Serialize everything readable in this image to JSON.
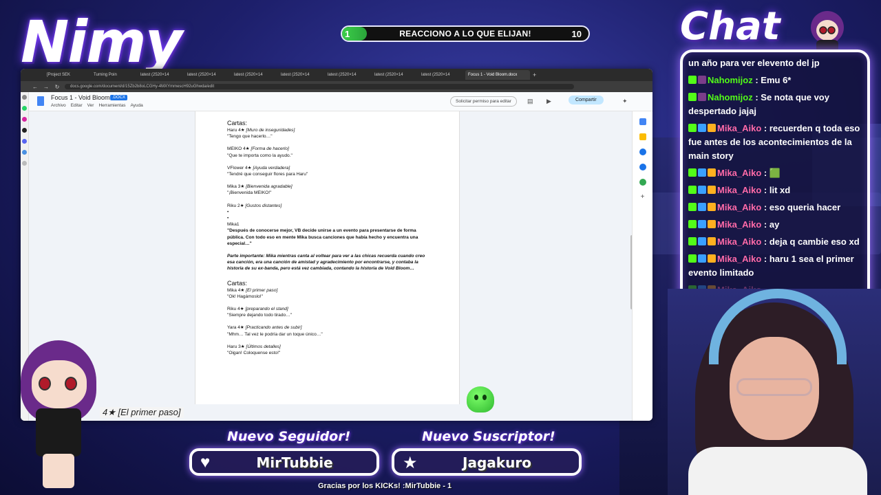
{
  "overlay": {
    "streamer_name": "Nimy",
    "chat_title": "Chat",
    "goal": {
      "label": "REACCIONO A LO QUE ELIJAN!",
      "current": "1",
      "target": "10",
      "progress": 0.1
    },
    "follower_title": "Nuevo Seguidor!",
    "follower_name": "MirTubbie",
    "sub_title": "Nuevo Suscriptor!",
    "sub_name": "Jagakuro",
    "footer": "Gracias por los KICKs! :MirTubbie - 1",
    "caption_peek": "4★ [El primer paso]"
  },
  "browser": {
    "tabs": [
      "[Project SEK",
      "Turning Poin",
      "latest (2520×14",
      "latest (2520×14",
      "latest (2520×14",
      "latest (2520×14",
      "latest (2520×14",
      "latest (2520×14",
      "latest (2520×14",
      "Focus 1 - Void Bloom.docx"
    ],
    "url": "docs.google.com/document/d/15Zb2b8oLCGHy-4MXYmmescH92uGhwda/edit",
    "doc": {
      "title": "Focus 1 - Void Bloom",
      "ext": ".DOCX",
      "menu": [
        "Archivo",
        "Editar",
        "Ver",
        "Herramientas",
        "Ayuda"
      ],
      "request_edit": "Solicitar permiso para editar",
      "share": "Compartir"
    }
  },
  "document": {
    "h1": "Cartas:",
    "c1_a": "Haru 4★ ",
    "c1_a_i": "[Muro de inseguridades]",
    "c1_a_q": "\"Tengo que hacerlo…\"",
    "c1_b": "MEIKO 4★ ",
    "c1_b_i": "[Forma de hacerlo]",
    "c1_b_q": "\"Que te importa como la ayudo.\"",
    "c1_c": "VFlower 4★ ",
    "c1_c_i": "[Ayuda verdadera]",
    "c1_c_q": "\"Tendré que conseguir flores para Haru\"",
    "c1_d": "Mika 3★ ",
    "c1_d_i": "[Bienvenida agradable]",
    "c1_d_q": "\"¡Bienvenida MEIKO!\"",
    "c1_e": "Riku 2★ ",
    "c1_e_i": "[Gustos distantes]",
    "bullet1": "•",
    "bullet2": "•",
    "mika": "Mika1",
    "para1": "\"Después de conocerse mejor, VB decide unirse a un evento para presentarse de forma pública. Con todo eso en mente Mika busca canciones que había hecho y encuentra una especial…\"",
    "para2": "Parte importante: Mika mientras canta al voltear para ver a las chicas recuerda cuando creo esa canción, era una canción de amistad y agradecimiento por encontrarse, y contaba la historia de su ex-banda, pero está vez cambiada, contando la historia de Void Bloom…",
    "h2": "Cartas:",
    "c2_a": "Mika 4★ ",
    "c2_a_i": "[El primer paso]",
    "c2_a_q": "\"Ok! Hagámoslo!\"",
    "c2_b": "Riku 4★ ",
    "c2_b_i": "[preparando el stand]",
    "c2_b_q": "\"Siempre dejando todo tirado…\"",
    "c2_c": "Yara 4★ ",
    "c2_c_i": "[Practicando antes de subir]",
    "c2_c_q": "\"Mhm… Tal vez le podría dar un toque único…\"",
    "c2_d": "Haru 3★ ",
    "c2_d_i": "[Últimos detalles]",
    "c2_d_q": "\"Oigan! Coloquense esto!\""
  },
  "chat": [
    {
      "badges": [],
      "user": "",
      "text": "un año para ver elevento del jp"
    },
    {
      "badges": [
        "k",
        "a"
      ],
      "user": "Nahomijoz",
      "color": "green",
      "text": " : Emu 6*"
    },
    {
      "badges": [
        "k",
        "a"
      ],
      "user": "Nahomijoz",
      "color": "green",
      "text": " : Se nota que voy despertado jajaj"
    },
    {
      "badges": [
        "k",
        "s",
        "c"
      ],
      "user": "Mika_Aiko",
      "color": "pink",
      "text": " : recuerden q toda eso fue antes de los acontecimientos de la main story"
    },
    {
      "badges": [
        "k",
        "s",
        "c"
      ],
      "user": "Mika_Aiko",
      "color": "pink",
      "text": " : 🟩"
    },
    {
      "badges": [
        "k",
        "s",
        "c"
      ],
      "user": "Mika_Aiko",
      "color": "pink",
      "text": " : lit xd"
    },
    {
      "badges": [
        "k",
        "s",
        "c"
      ],
      "user": "Mika_Aiko",
      "color": "pink",
      "text": " : eso queria hacer"
    },
    {
      "badges": [
        "k",
        "s",
        "c"
      ],
      "user": "Mika_Aiko",
      "color": "pink",
      "text": " : ay"
    },
    {
      "badges": [
        "k",
        "s",
        "c"
      ],
      "user": "Mika_Aiko",
      "color": "pink",
      "text": " : deja q cambie eso xd"
    },
    {
      "badges": [
        "k",
        "s",
        "c"
      ],
      "user": "Mika_Aiko",
      "color": "pink",
      "text": " : haru 1 sea el primer evento limitado"
    },
    {
      "badges": [
        "k",
        "s",
        "c"
      ],
      "user": "Mika_Aiko",
      "color": "pink",
      "text": "",
      "faded": true
    }
  ]
}
